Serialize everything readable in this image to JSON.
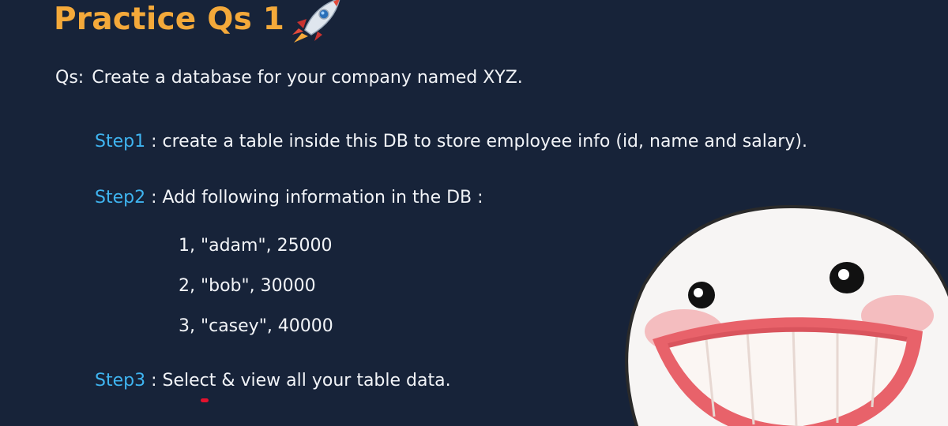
{
  "slide": {
    "title": "Practice Qs 1",
    "question_prefix": "Qs:",
    "question_text": "Create a database for your company named XYZ.",
    "steps": [
      {
        "label": "Step1",
        "text": ": create a table inside this DB to store employee info (id, name and salary)."
      },
      {
        "label": "Step2",
        "text": ": Add following information in the DB :"
      },
      {
        "label": "Step3",
        "text": ": Select & view all your table data."
      }
    ],
    "rows": [
      "1, \"adam\", 25000",
      "2, \"bob\", 30000",
      "3, \"casey\", 40000"
    ]
  },
  "colors": {
    "background": "#172339",
    "title": "#f4a93a",
    "step_label": "#3fb4f0",
    "body_text": "#f2f4f8",
    "cursor": "#e3122e"
  },
  "icons": {
    "title_decoration": "rocket-icon",
    "overlay_sticker": "smiling-face-sticker"
  }
}
